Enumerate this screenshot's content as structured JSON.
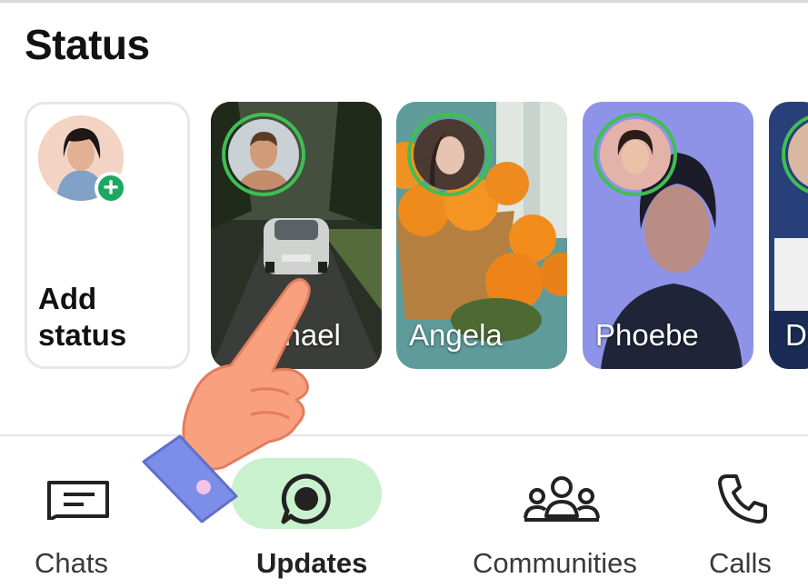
{
  "header": {
    "title": "Status"
  },
  "status_cards": [
    {
      "label": "Add status",
      "line1": "Add",
      "line2": "status"
    },
    {
      "name": "chael"
    },
    {
      "name": "Angela"
    },
    {
      "name": "Phoebe"
    },
    {
      "name": "De"
    }
  ],
  "bottom_nav": [
    {
      "label": "Chats",
      "icon": "chats-icon"
    },
    {
      "label": "Updates",
      "icon": "updates-icon",
      "selected": true
    },
    {
      "label": "Communities",
      "icon": "communities-icon"
    },
    {
      "label": "Calls",
      "icon": "calls-icon"
    }
  ],
  "colors": {
    "accent_green": "#1da862",
    "ring_green": "#3fbf52",
    "selected_pill": "#c9f1cd"
  }
}
